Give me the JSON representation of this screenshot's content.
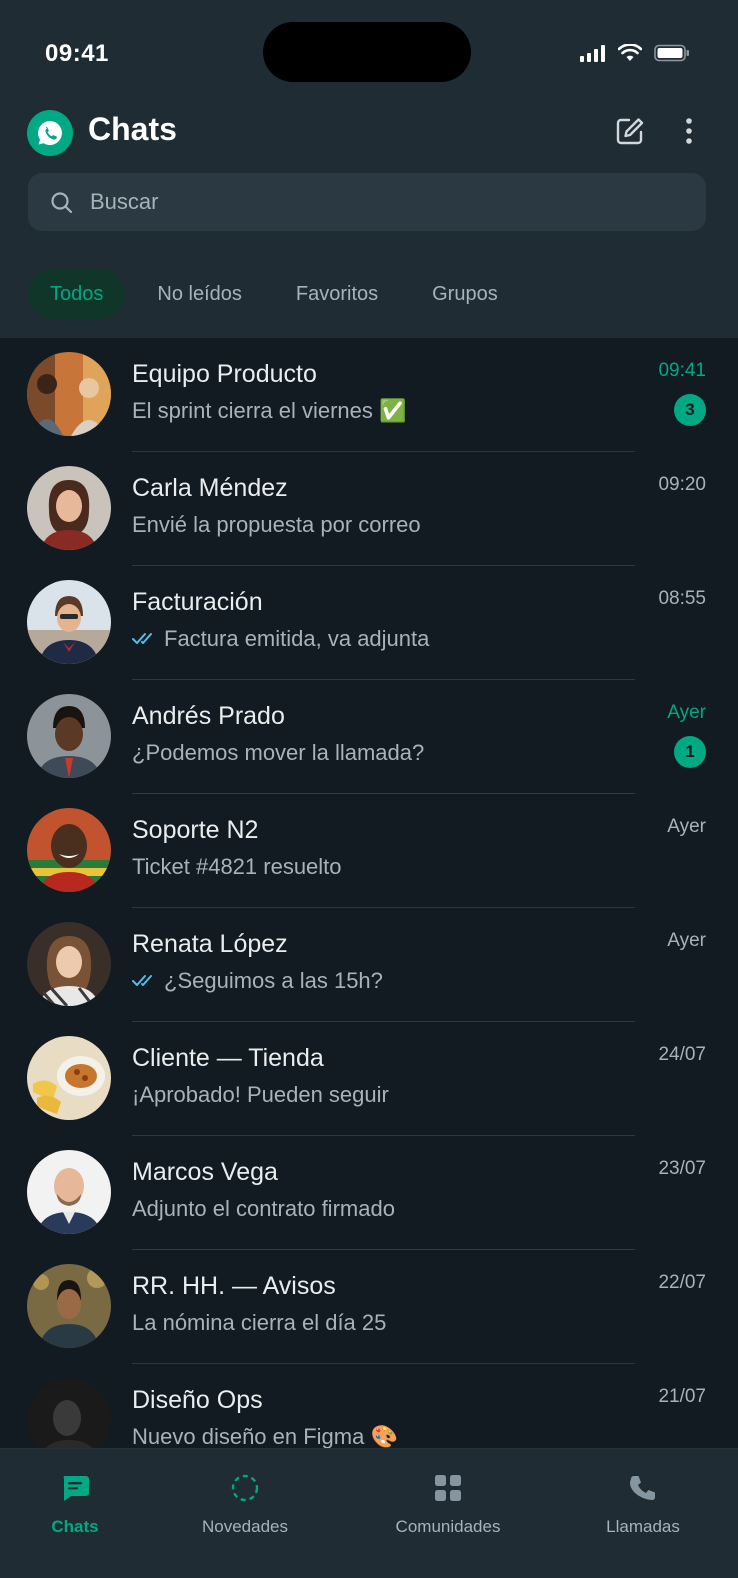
{
  "status_bar": {
    "time": "09:41"
  },
  "header": {
    "title": "Chats",
    "logo_icon": "whatsapp-logo-icon",
    "compose_icon": "compose-icon",
    "menu_icon": "more-vertical-icon"
  },
  "search": {
    "placeholder": "Buscar",
    "value": ""
  },
  "filters": [
    {
      "label": "Todos",
      "active": true
    },
    {
      "label": "No leídos",
      "active": false
    },
    {
      "label": "Favoritos",
      "active": false
    },
    {
      "label": "Grupos",
      "active": false
    }
  ],
  "chats": [
    {
      "name": "Equipo Producto",
      "message": "El sprint cierra el viernes ✅",
      "time": "09:41",
      "unread": "3",
      "read_receipt": false
    },
    {
      "name": "Carla Méndez",
      "message": "Envié la propuesta por correo",
      "time": "09:20",
      "unread": "",
      "read_receipt": false
    },
    {
      "name": "Facturación",
      "message": "Factura emitida, va adjunta",
      "time": "08:55",
      "unread": "",
      "read_receipt": true
    },
    {
      "name": "Andrés Prado",
      "message": "¿Podemos mover la llamada?",
      "time": "Ayer",
      "unread": "1",
      "read_receipt": false
    },
    {
      "name": "Soporte N2",
      "message": "Ticket #4821 resuelto",
      "time": "Ayer",
      "unread": "",
      "read_receipt": false
    },
    {
      "name": "Renata López",
      "message": "¿Seguimos a las 15h?",
      "time": "Ayer",
      "unread": "",
      "read_receipt": true
    },
    {
      "name": "Cliente — Tienda",
      "message": "¡Aprobado! Pueden seguir",
      "time": "24/07",
      "unread": "",
      "read_receipt": false
    },
    {
      "name": "Marcos Vega",
      "message": "Adjunto el contrato firmado",
      "time": "23/07",
      "unread": "",
      "read_receipt": false
    },
    {
      "name": "RR. HH. — Avisos",
      "message": "La nómina cierra el día 25",
      "time": "22/07",
      "unread": "",
      "read_receipt": false
    },
    {
      "name": "Diseño Ops",
      "message": "Nuevo diseño en Figma 🎨",
      "time": "21/07",
      "unread": "",
      "read_receipt": false
    }
  ],
  "bottom_nav": [
    {
      "label": "Chats",
      "icon": "chat-bubble-icon",
      "active": true
    },
    {
      "label": "Novedades",
      "icon": "status-ring-icon",
      "active": false
    },
    {
      "label": "Comunidades",
      "icon": "communities-grid-icon",
      "active": false
    },
    {
      "label": "Llamadas",
      "icon": "phone-icon",
      "active": false
    }
  ],
  "colors": {
    "accent": "#00a884",
    "background": "#111b21",
    "header": "#1f2c34",
    "search": "#2a3942",
    "read_tick": "#53bdeb"
  }
}
